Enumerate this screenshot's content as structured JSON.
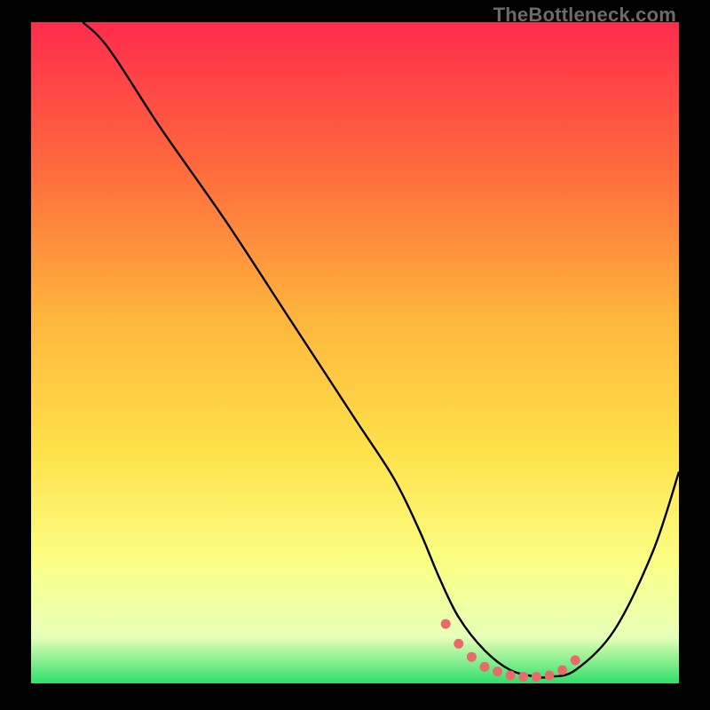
{
  "watermark": "TheBottleneck.com",
  "colors": {
    "black": "#000000",
    "curve": "#000000",
    "dots": "#e86a6a",
    "grad_top": "#ff2b4c",
    "grad_mid1": "#ff6a3d",
    "grad_mid2": "#ffb63d",
    "grad_mid3": "#ffe24a",
    "grad_mid4": "#fbff86",
    "grad_mid5": "#e7ffb8",
    "grad_bottom": "#2fe06a"
  },
  "chart_data": {
    "type": "line",
    "title": "",
    "xlabel": "",
    "ylabel": "",
    "xlim": [
      0,
      100
    ],
    "ylim": [
      0,
      100
    ],
    "series": [
      {
        "name": "bottleneck-curve",
        "x": [
          8,
          12,
          20,
          30,
          40,
          50,
          56,
          60,
          63,
          66,
          70,
          74,
          78,
          80,
          84,
          90,
          96,
          100
        ],
        "y": [
          100,
          96,
          84,
          70,
          55,
          40,
          31,
          23,
          16,
          10,
          5,
          2,
          1,
          1,
          2,
          8,
          20,
          32
        ]
      }
    ],
    "highlight_points": {
      "name": "optimal-region-dots",
      "x": [
        64,
        66,
        68,
        70,
        72,
        74,
        76,
        78,
        80,
        82,
        84
      ],
      "y": [
        9,
        6,
        4,
        2.5,
        1.8,
        1.2,
        1,
        1,
        1.2,
        2,
        3.5
      ]
    }
  }
}
